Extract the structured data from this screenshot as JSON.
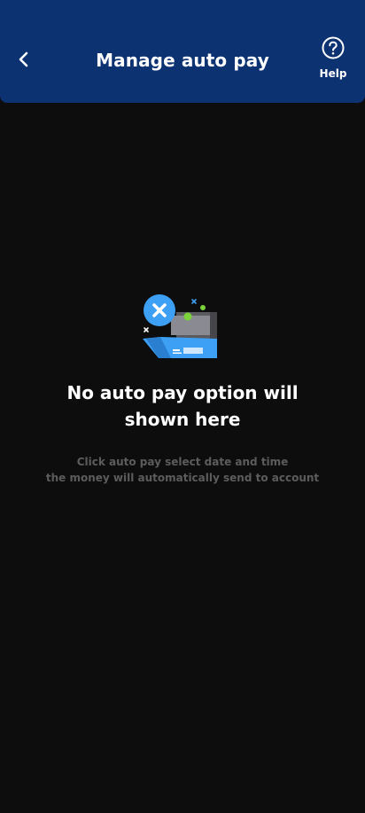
{
  "header": {
    "title": "Manage auto pay",
    "help_label": "Help",
    "back_icon": "chevron-left-icon",
    "help_icon": "question-circle-icon"
  },
  "empty_state": {
    "illustration": "card-error-illustration",
    "title": "No auto pay option will shown here",
    "description_line1": "Click auto pay select date and time",
    "description_line2": "the money will automatically send to account"
  },
  "colors": {
    "header_bg": "#0d3272",
    "page_bg": "#0d0d0d",
    "accent_blue": "#3da0f5",
    "description_text": "#5c5c5c"
  }
}
